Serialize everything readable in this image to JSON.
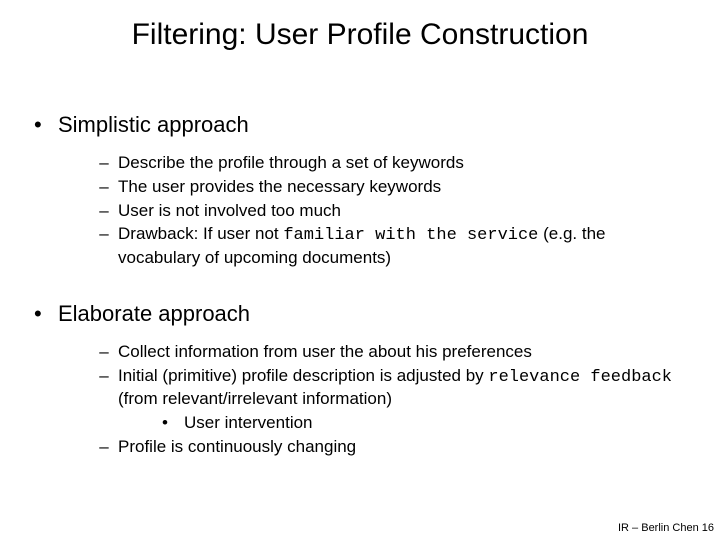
{
  "title": "Filtering: User Profile Construction",
  "section1": {
    "heading": "Simplistic approach",
    "items": {
      "a": "Describe the profile through a set of keywords",
      "b": "The user provides the necessary keywords",
      "c": "User is not involved too much",
      "d_pre": "Drawback: If user not ",
      "d_code": "familiar with the service",
      "d_post": " (e.g. the vocabulary of upcoming documents)"
    }
  },
  "section2": {
    "heading": "Elaborate approach",
    "items": {
      "a": "Collect information from user the about his preferences",
      "b_pre": "Initial (primitive) profile description is adjusted by ",
      "b_code": "relevance feedback",
      "b_post": " (from relevant/irrelevant information)",
      "b_sub": "User intervention",
      "c": "Profile is continuously changing"
    }
  },
  "footer": "IR – Berlin Chen 16"
}
